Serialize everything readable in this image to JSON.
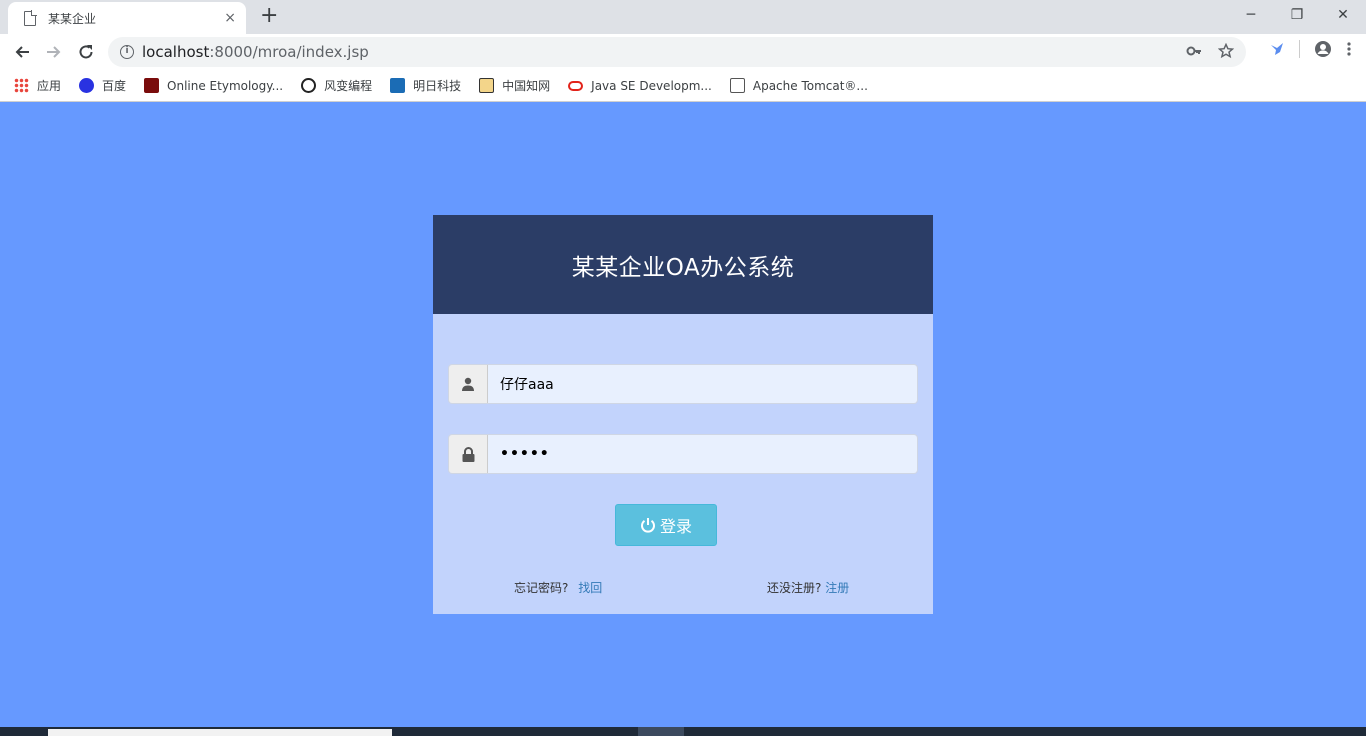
{
  "browser": {
    "tab_title": "某某企业",
    "tab_close": "×",
    "new_tab": "+",
    "url_host": "localhost",
    "url_rest": ":8000/mroa/index.jsp",
    "win_minimize": "─",
    "win_restore": "❐",
    "win_close": "✕"
  },
  "bookmarks": [
    {
      "label": "应用",
      "color": "#e8453c"
    },
    {
      "label": "百度",
      "color": "#2932e1"
    },
    {
      "label": "Online Etymology...",
      "color": "#7a0c0c"
    },
    {
      "label": "风变编程",
      "color": "#222222"
    },
    {
      "label": "明日科技",
      "color": "#1b6cb5"
    },
    {
      "label": "中国知网",
      "color": "#b8860b"
    },
    {
      "label": "Java SE Developm...",
      "color": "#e2231a"
    },
    {
      "label": "Apache Tomcat®...",
      "color": "#555555"
    }
  ],
  "login": {
    "title": "某某企业OA办公系统",
    "username_value": "仔仔aaa",
    "password_value": "•••••",
    "login_label": "登录",
    "forgot_text": "忘记密码?",
    "forgot_link": "找回",
    "register_text": "还没注册?",
    "register_link": "注册"
  },
  "colors": {
    "page_bg": "#6699ff",
    "card_header": "#2b3d66",
    "card_body": "#c2d3fc",
    "button": "#5bc0de",
    "link": "#337ab7"
  }
}
